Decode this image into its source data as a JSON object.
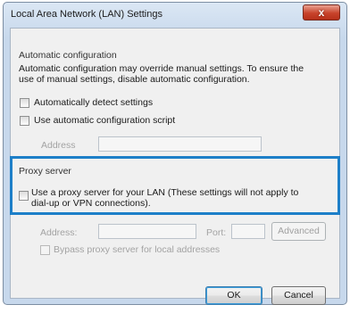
{
  "window": {
    "title": "Local Area Network (LAN) Settings",
    "close_glyph": "x"
  },
  "automatic": {
    "group_label": "Automatic configuration",
    "description_line1": "Automatic configuration may override manual settings.  To ensure the",
    "description_line2": "use of manual settings, disable automatic configuration.",
    "detect_label": "Automatically detect settings",
    "detect_checked": false,
    "script_label": "Use automatic configuration script",
    "script_checked": false,
    "address_label": "Address",
    "address_value": ""
  },
  "proxy": {
    "group_label": "Proxy server",
    "use_proxy_line1": "Use a proxy server for your LAN (These settings will not apply to",
    "use_proxy_line2": "dial-up or VPN connections).",
    "use_proxy_checked": false,
    "address_label": "Address:",
    "address_value": "",
    "port_label": "Port:",
    "port_value": "",
    "advanced_label": "Advanced",
    "bypass_label": "Bypass proxy server for local addresses",
    "bypass_checked": false
  },
  "buttons": {
    "ok_label": "OK",
    "cancel_label": "Cancel"
  },
  "colors": {
    "highlight_box": "#1d7fc8",
    "title_bar": "#c7d8ec",
    "close_button": "#c8432b"
  }
}
